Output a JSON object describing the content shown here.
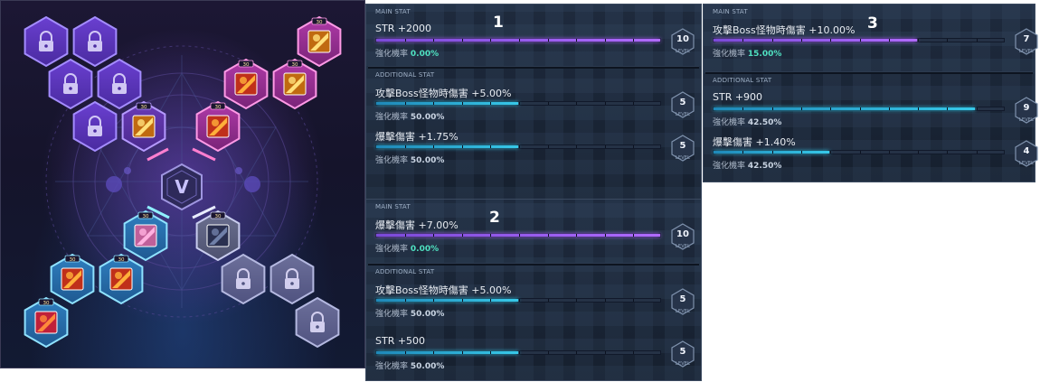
{
  "board": {
    "center_emblem": "V",
    "node_badge": "30"
  },
  "panels": [
    {
      "number": "1",
      "main": {
        "label": "MAIN STAT",
        "stat": "STR +2000",
        "rate_label": "強化機率",
        "rate_value": "0.00%",
        "level": "10",
        "level_word": "LEVEL",
        "fill": 1.0,
        "color": "#b06bff"
      },
      "additional": {
        "label": "ADDITIONAL STAT",
        "rows": [
          {
            "stat": "攻擊Boss怪物時傷害 +5.00%",
            "rate_label": "強化機率",
            "rate_value": "50.00%",
            "level": "5",
            "level_word": "LEVEL",
            "fill": 0.5
          },
          {
            "stat": "爆擊傷害 +1.75%",
            "rate_label": "強化機率",
            "rate_value": "50.00%",
            "level": "5",
            "level_word": "LEVEL",
            "fill": 0.5
          }
        ]
      }
    },
    {
      "number": "2",
      "main": {
        "label": "MAIN STAT",
        "stat": "爆擊傷害 +7.00%",
        "rate_label": "強化機率",
        "rate_value": "0.00%",
        "level": "10",
        "level_word": "LEVEL",
        "fill": 1.0,
        "color": "#b06bff"
      },
      "additional": {
        "label": "ADDITIONAL STAT",
        "rows": [
          {
            "stat": "攻擊Boss怪物時傷害 +5.00%",
            "rate_label": "強化機率",
            "rate_value": "50.00%",
            "level": "5",
            "level_word": "LEVEL",
            "fill": 0.5
          },
          {
            "stat": "STR +500",
            "rate_label": "強化機率",
            "rate_value": "50.00%",
            "level": "5",
            "level_word": "LEVEL",
            "fill": 0.5
          }
        ]
      }
    },
    {
      "number": "3",
      "main": {
        "label": "MAIN STAT",
        "stat": "攻擊Boss怪物時傷害 +10.00%",
        "rate_label": "強化機率",
        "rate_value": "15.00%",
        "level": "7",
        "level_word": "LEVEL",
        "fill": 0.7,
        "color": "#b06bff"
      },
      "additional": {
        "label": "ADDITIONAL STAT",
        "rows": [
          {
            "stat": "STR +900",
            "rate_label": "強化機率",
            "rate_value": "42.50%",
            "level": "9",
            "level_word": "LEVEL",
            "fill": 0.9
          },
          {
            "stat": "爆擊傷害 +1.40%",
            "rate_label": "強化機率",
            "rate_value": "42.50%",
            "level": "4",
            "level_word": "LEVEL",
            "fill": 0.4
          }
        ]
      }
    }
  ],
  "colors": {
    "main_fill": "#b06bff",
    "add_fill": "#37c8e8",
    "rate_main": "#4fe0c0",
    "level_hex": "#27344a"
  }
}
